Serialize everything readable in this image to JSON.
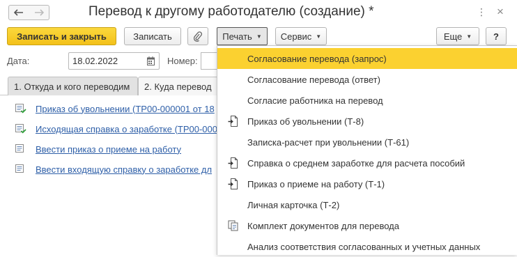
{
  "window": {
    "title": "Перевод к другому работодателю (создание) *"
  },
  "toolbar": {
    "save_close_label": "Записать и закрыть",
    "save_label": "Записать",
    "print_label": "Печать",
    "service_label": "Сервис",
    "more_label": "Еще",
    "help_label": "?"
  },
  "form": {
    "date_label": "Дата:",
    "date_value": "18.02.2022",
    "number_label": "Номер:"
  },
  "tabs": [
    {
      "label": "1. Откуда и кого переводим"
    },
    {
      "label": "2. Куда перевод"
    }
  ],
  "links": [
    {
      "text": "Приказ об увольнении (ТР00-000001 от 18",
      "icon": "document-posted-icon"
    },
    {
      "text": "Исходящая справка о заработке (ТР00-000",
      "icon": "document-posted-icon"
    },
    {
      "text": "Ввести приказ о приеме на работу",
      "icon": "document-icon"
    },
    {
      "text": "Ввести входящую справку о заработке дл",
      "icon": "document-icon"
    }
  ],
  "print_menu": [
    {
      "label": "Согласование перевода (запрос)",
      "icon": "",
      "selected": true
    },
    {
      "label": "Согласование перевода (ответ)",
      "icon": ""
    },
    {
      "label": "Согласие работника на перевод",
      "icon": ""
    },
    {
      "label": "Приказ об увольнении (Т-8)",
      "icon": "print-form-icon"
    },
    {
      "label": "Записка-расчет при увольнении (Т-61)",
      "icon": ""
    },
    {
      "label": "Справка о среднем заработке для расчета пособий",
      "icon": "print-form-icon"
    },
    {
      "label": "Приказ о приеме на работу (Т-1)",
      "icon": "print-form-icon"
    },
    {
      "label": "Личная карточка (Т-2)",
      "icon": ""
    },
    {
      "label": "Комплект документов для перевода",
      "icon": "document-set-icon"
    },
    {
      "label": "Анализ соответствия согласованных и учетных данных",
      "icon": ""
    }
  ],
  "colors": {
    "primary_button": "#f3c11a",
    "selected_item": "#fbd130",
    "link": "#2e5fa8"
  }
}
